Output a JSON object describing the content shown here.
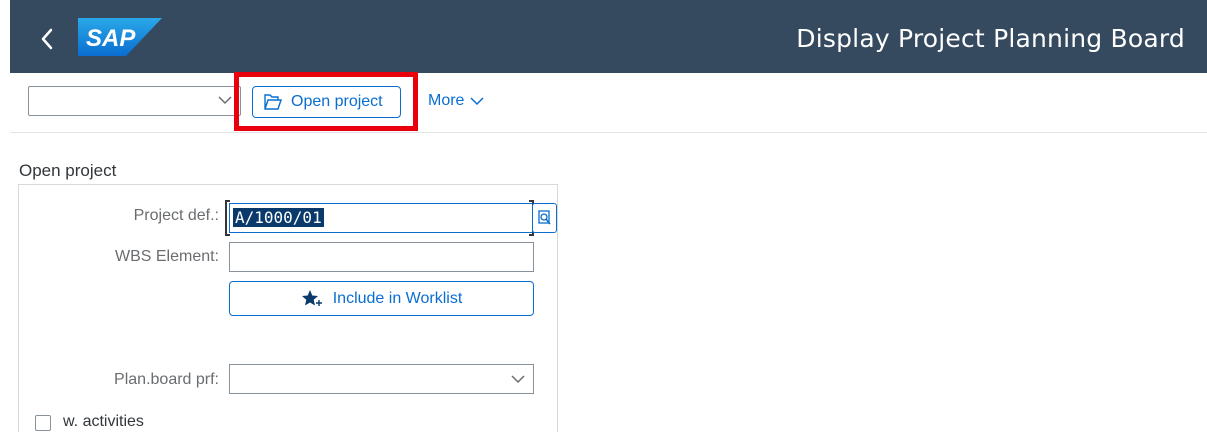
{
  "shell": {
    "title": "Display Project Planning Board",
    "logo_text": "SAP",
    "background": "#354a5f"
  },
  "toolbar": {
    "dropdown_value": "",
    "open_project_label": "Open project",
    "more_label": "More",
    "accent": "#0a6ed1",
    "highlight_color": "#e8000d"
  },
  "form": {
    "section_title": "Open project",
    "project_def_label": "Project def.:",
    "project_def_value": "A/1000/01",
    "wbs_label": "WBS Element:",
    "wbs_value": "",
    "include_label": "Include in Worklist",
    "planboard_label": "Plan.board prf:",
    "planboard_value": "",
    "activities_label": "w. activities",
    "activities_checked": false
  },
  "icons": [
    "back-icon",
    "sap-logo",
    "chevron-down-icon",
    "open-folder-icon",
    "value-help-icon",
    "star-add-icon"
  ]
}
